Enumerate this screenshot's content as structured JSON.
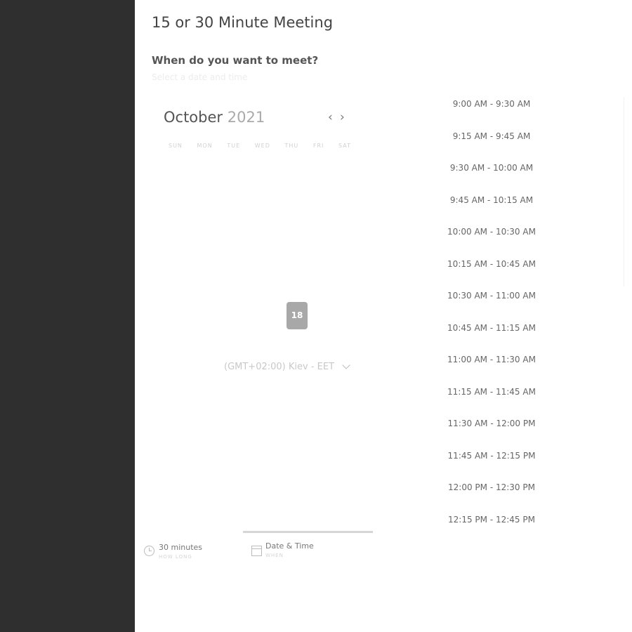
{
  "meeting": {
    "title": "15 or 30 Minute Meeting",
    "question": "When do you want to meet?",
    "hint": "Select a date and time"
  },
  "calendar": {
    "month": "October",
    "year": "2021",
    "weekdays": [
      "SUN",
      "MON",
      "TUE",
      "WED",
      "THU",
      "FRI",
      "SAT"
    ],
    "selected_day": "18",
    "timezone": "(GMT+02:00) Kiev - EET"
  },
  "time_slots": [
    "9:00 AM - 9:30 AM",
    "9:15 AM - 9:45 AM",
    "9:30 AM - 10:00 AM",
    "9:45 AM - 10:15 AM",
    "10:00 AM - 10:30 AM",
    "10:15 AM - 10:45 AM",
    "10:30 AM - 11:00 AM",
    "10:45 AM - 11:15 AM",
    "11:00 AM - 11:30 AM",
    "11:15 AM - 11:45 AM",
    "11:30 AM - 12:00 PM",
    "11:45 AM - 12:15 PM",
    "12:00 PM - 12:30 PM",
    "12:15 PM - 12:45 PM"
  ],
  "steps": [
    {
      "label": "30 minutes",
      "sub": "HOW LONG"
    },
    {
      "label": "Date & Time",
      "sub": "WHEN"
    }
  ],
  "colors": {
    "sidebar": "#2f2f2f",
    "selected_day": "#a8a8a8",
    "background": "#ffffff"
  }
}
